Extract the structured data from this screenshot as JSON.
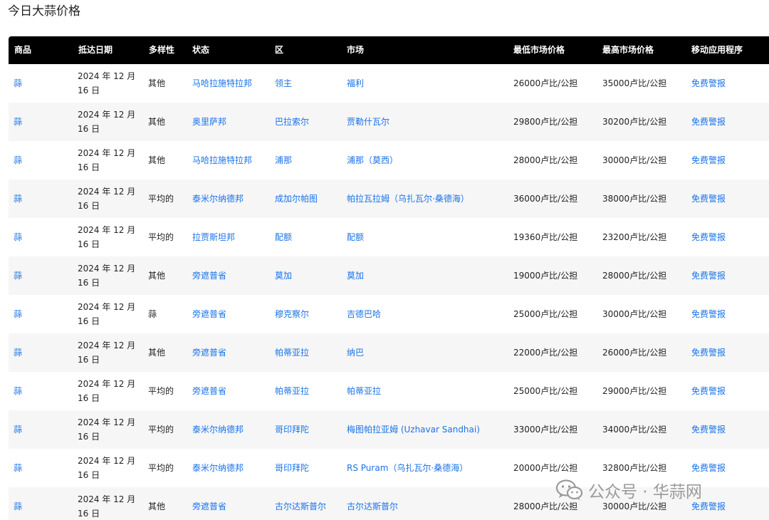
{
  "page_title": "今日大蒜价格",
  "table": {
    "headers": [
      "商品",
      "抵达日期",
      "多样性",
      "状态",
      "区",
      "市场",
      "最低市场价格",
      "最高市场价格",
      "移动应用程序"
    ],
    "rows": [
      {
        "commodity": "蒜",
        "date": "2024 年 12 月 16 日",
        "variety": "其他",
        "state": "马哈拉施特拉邦",
        "district": "领主",
        "market": "福利",
        "min_price": "26000卢比/公担",
        "max_price": "35000卢比/公担",
        "app": "免费警报"
      },
      {
        "commodity": "蒜",
        "date": "2024 年 12 月 16 日",
        "variety": "其他",
        "state": "奥里萨邦",
        "district": "巴拉索尔",
        "market": "贾勒什瓦尔",
        "min_price": "29800卢比/公担",
        "max_price": "30200卢比/公担",
        "app": "免费警报"
      },
      {
        "commodity": "蒜",
        "date": "2024 年 12 月 16 日",
        "variety": "其他",
        "state": "马哈拉施特拉邦",
        "district": "浦那",
        "market": "浦那（莫西）",
        "min_price": "28000卢比/公担",
        "max_price": "30000卢比/公担",
        "app": "免费警报"
      },
      {
        "commodity": "蒜",
        "date": "2024 年 12 月 16 日",
        "variety": "平均的",
        "state": "泰米尔纳德邦",
        "district": "成加尔帕图",
        "market": "帕拉瓦拉姆（乌扎瓦尔·桑德海）",
        "min_price": "36000卢比/公担",
        "max_price": "38000卢比/公担",
        "app": "免费警报"
      },
      {
        "commodity": "蒜",
        "date": "2024 年 12 月 16 日",
        "variety": "平均的",
        "state": "拉贾斯坦邦",
        "district": "配额",
        "market": "配额",
        "min_price": "19360卢比/公担",
        "max_price": "23200卢比/公担",
        "app": "免费警报"
      },
      {
        "commodity": "蒜",
        "date": "2024 年 12 月 16 日",
        "variety": "其他",
        "state": "旁遮普省",
        "district": "莫加",
        "market": "莫加",
        "min_price": "19000卢比/公担",
        "max_price": "28000卢比/公担",
        "app": "免费警报"
      },
      {
        "commodity": "蒜",
        "date": "2024 年 12 月 16 日",
        "variety": "蒜",
        "state": "旁遮普省",
        "district": "穆克察尔",
        "market": "吉德巴哈",
        "min_price": "25000卢比/公担",
        "max_price": "30000卢比/公担",
        "app": "免费警报"
      },
      {
        "commodity": "蒜",
        "date": "2024 年 12 月 16 日",
        "variety": "其他",
        "state": "旁遮普省",
        "district": "帕蒂亚拉",
        "market": "纳巴",
        "min_price": "22000卢比/公担",
        "max_price": "26000卢比/公担",
        "app": "免费警报"
      },
      {
        "commodity": "蒜",
        "date": "2024 年 12 月 16 日",
        "variety": "平均的",
        "state": "旁遮普省",
        "district": "帕蒂亚拉",
        "market": "帕蒂亚拉",
        "min_price": "25000卢比/公担",
        "max_price": "29000卢比/公担",
        "app": "免费警报"
      },
      {
        "commodity": "蒜",
        "date": "2024 年 12 月 16 日",
        "variety": "平均的",
        "state": "泰米尔纳德邦",
        "district": "哥印拜陀",
        "market": "梅图帕拉亚姆 (Uzhavar Sandhai)",
        "min_price": "33000卢比/公担",
        "max_price": "34000卢比/公担",
        "app": "免费警报"
      },
      {
        "commodity": "蒜",
        "date": "2024 年 12 月 16 日",
        "variety": "平均的",
        "state": "泰米尔纳德邦",
        "district": "哥印拜陀",
        "market": "RS Puram（乌扎瓦尔·桑德海）",
        "min_price": "20000卢比/公担",
        "max_price": "32800卢比/公担",
        "app": "免费警报"
      },
      {
        "commodity": "蒜",
        "date": "2024 年 12 月 16 日",
        "variety": "其他",
        "state": "旁遮普省",
        "district": "古尔达斯普尔",
        "market": "古尔达斯普尔",
        "min_price": "28000卢比/公担",
        "max_price": "30000卢比/公担",
        "app": "免费警报"
      }
    ]
  },
  "watermark": {
    "text": "公众号 · 华蒜网",
    "icon": "wechat-icon",
    "color": "#9a9a9a"
  },
  "colors": {
    "link": "#1a73e8",
    "header_bg": "#000000",
    "header_text": "#ffffff",
    "row_alt": "#f6f6f6"
  }
}
